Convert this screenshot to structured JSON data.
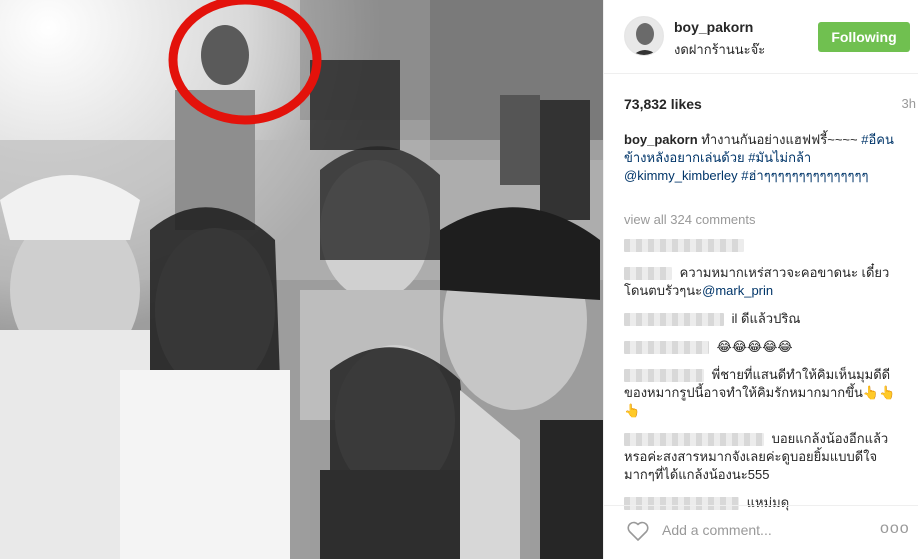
{
  "post": {
    "username": "boy_pakorn",
    "subtitle": "งดฝากร้านนะจ๊ะ",
    "follow_label": "Following",
    "likes": "73,832 likes",
    "time": "3h",
    "caption_user": "boy_pakorn",
    "caption_text": " ทำงานกันอย่างแฮฟฟรี้~~~~ ",
    "caption_line2": "#อีคนข้างหลังอยากเล่นด้วย",
    "caption_tag2": "#มันไม่กล้า",
    "caption_mention": "@kimmy_kimberley",
    "caption_tag3": "#ฮ่าๆๆๆๆๆๆๆๆๆๆๆๆๆๆๆ",
    "view_all": "view all 324 comments"
  },
  "comments": [
    {
      "text": ""
    },
    {
      "text": "ความหมากเหร่สาวจะคอขาดนะ เดี๋ยวโดนตบรัวๆนะ",
      "mention": "@mark_prin"
    },
    {
      "text": "il ดีแล้วปริณ"
    },
    {
      "text": "😂😂😂😂😂"
    },
    {
      "text": "พี่ชายที่แสนดีทำให้คิมเห็นมุมดีดีของหมากรูปนี้อาจทำให้คิมรักหมากมากขึ้น👆👆👆"
    },
    {
      "text": "บอยแกล้งน้องอีกแล้วหรอค่ะสงสารหมากจังเลยค่ะดูบอยยิ้มแบบดีใจมากๆที่ได้แกล้งน้องนะ555"
    },
    {
      "text": "แหม่มดุ"
    }
  ],
  "footer": {
    "add_comment_placeholder": "Add a comment...",
    "more_label": "ooo"
  }
}
